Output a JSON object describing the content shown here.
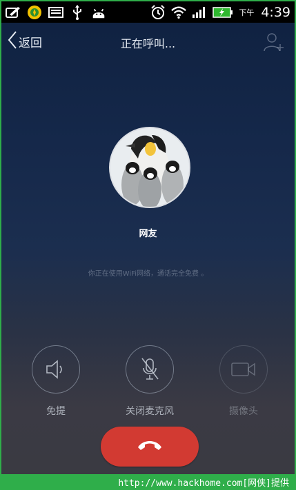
{
  "status_bar": {
    "left_icons": [
      "notes-icon",
      "clean-master-icon",
      "keyboard-icon",
      "usb-icon",
      "android-icon"
    ],
    "right_icons": [
      "alarm-icon",
      "wifi-icon",
      "signal-icon",
      "battery-charging-icon"
    ],
    "ampm": "下午",
    "time": "4:39"
  },
  "nav": {
    "back_label": "返回",
    "title": "正在呼叫...",
    "add_contact_icon": "add-contact-icon"
  },
  "contact": {
    "name": "网友",
    "avatar_icon": "penguins-avatar"
  },
  "network_note": "你正在使用WiFi网络，通话完全免费 。",
  "controls": [
    {
      "label": "免提",
      "icon": "speaker-icon",
      "enabled": true
    },
    {
      "label": "关闭麦克风",
      "icon": "mic-off-icon",
      "enabled": true
    },
    {
      "label": "摄像头",
      "icon": "camera-icon",
      "enabled": false
    }
  ],
  "hangup": {
    "icon": "hang-up-icon",
    "color": "#d23a32"
  },
  "footer_watermark": "http://www.hackhome.com[网侠]提供",
  "colors": {
    "frame_green": "#2fae4a",
    "hangup_red": "#d23a32"
  }
}
